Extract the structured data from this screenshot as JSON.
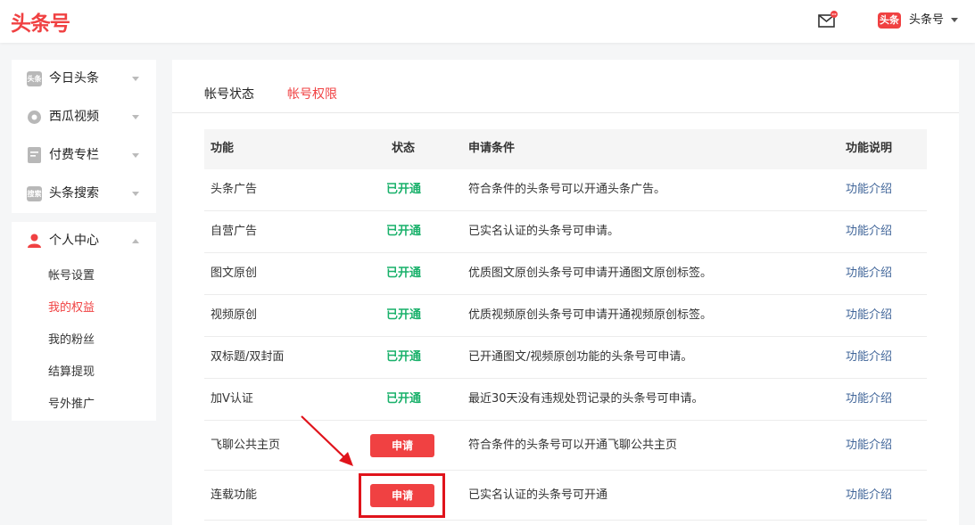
{
  "header": {
    "logo": "头条号",
    "user_badge": "头条",
    "user_name": "头条号"
  },
  "sidebar": {
    "groups": [
      {
        "label": "今日头条",
        "icon_text": "头条"
      },
      {
        "label": "西瓜视频",
        "icon_text": ""
      },
      {
        "label": "付费专栏",
        "icon_text": ""
      },
      {
        "label": "头条搜索",
        "icon_text": "搜索"
      }
    ],
    "personal": {
      "label": "个人中心",
      "items": [
        "帐号设置",
        "我的权益",
        "我的粉丝",
        "结算提现",
        "号外推广"
      ],
      "active_index": 1
    }
  },
  "tabs": [
    "帐号状态",
    "帐号权限"
  ],
  "table": {
    "headers": [
      "功能",
      "状态",
      "申请条件",
      "功能说明"
    ],
    "rows": [
      {
        "feature": "头条广告",
        "status": "已开通",
        "condition": "符合条件的头条号可以开通头条广告。",
        "link": "功能介绍"
      },
      {
        "feature": "自营广告",
        "status": "已开通",
        "condition": "已实名认证的头条号可申请。",
        "link": "功能介绍"
      },
      {
        "feature": "图文原创",
        "status": "已开通",
        "condition": "优质图文原创头条号可申请开通图文原创标签。",
        "link": "功能介绍"
      },
      {
        "feature": "视频原创",
        "status": "已开通",
        "condition": "优质视频原创头条号可申请开通视频原创标签。",
        "link": "功能介绍"
      },
      {
        "feature": "双标题/双封面",
        "status": "已开通",
        "condition": "已开通图文/视频原创功能的头条号可申请。",
        "link": "功能介绍"
      },
      {
        "feature": "加V认证",
        "status": "已开通",
        "condition": "最近30天没有违规处罚记录的头条号可申请。",
        "link": "功能介绍"
      },
      {
        "feature": "飞聊公共主页",
        "status": "申请",
        "condition": "符合条件的头条号可以开通飞聊公共主页",
        "link": "功能介绍"
      },
      {
        "feature": "连载功能",
        "status": "申请",
        "condition": "已实名认证的头条号可开通",
        "link": "功能介绍"
      }
    ]
  },
  "colors": {
    "brand": "#f04142",
    "open": "#1ab16b",
    "link": "#406599",
    "highlight": "#e0131b"
  }
}
